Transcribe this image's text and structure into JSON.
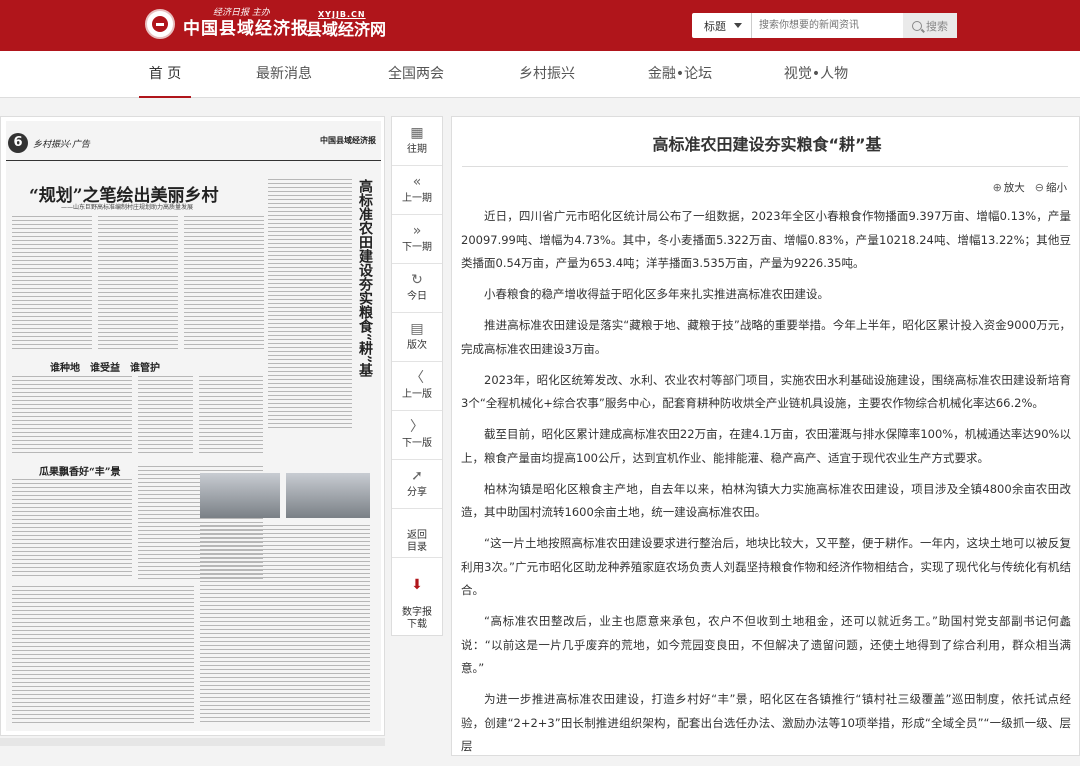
{
  "header": {
    "logo_sub": "经济日报 主办",
    "logo_main": "中国县域经济报",
    "logo2_url": "XYJJB.CN",
    "logo2_main": "县域经济网",
    "search": {
      "select_label": "标题",
      "placeholder": "搜索你想要的新闻资讯",
      "button_label": "搜索"
    }
  },
  "nav": {
    "items": [
      "首 页",
      "最新消息",
      "全国两会",
      "乡村振兴",
      "金融•论坛",
      "视觉•人物"
    ]
  },
  "paper": {
    "page_num": "6",
    "section": "乡村振兴·广告",
    "name": "中国县域经济报",
    "headline": "“规划”之笔绘出美丽乡村",
    "headline_sub": "——山东巨野高标准编制村庄规划助力高质量发展",
    "vertical_headline": "高标准农田建设夯实粮食“耕”基",
    "sub_headline_1": "谁种地　谁受益　谁管护",
    "sub_headline_2": "瓜果飘香好“丰”景"
  },
  "sidebar": {
    "items": [
      {
        "label": "往期",
        "icon": "calendar-icon"
      },
      {
        "label": "上一期",
        "icon": "double-chevron-left-icon"
      },
      {
        "label": "下一期",
        "icon": "double-chevron-right-icon"
      },
      {
        "label": "今日",
        "icon": "refresh-icon"
      },
      {
        "label": "版次",
        "icon": "list-icon"
      },
      {
        "label": "上一版",
        "icon": "circle-chevron-left-icon"
      },
      {
        "label": "下一版",
        "icon": "circle-chevron-right-icon"
      },
      {
        "label": "分享",
        "icon": "share-icon"
      },
      {
        "label": "返回\n目录",
        "icon": ""
      },
      {
        "label": "数字报\n下载",
        "icon": "download-icon"
      }
    ]
  },
  "article": {
    "title": "高标准农田建设夯实粮食“耕”基",
    "zoom_in": "放大",
    "zoom_out": "缩小",
    "paragraphs": [
      "近日，四川省广元市昭化区统计局公布了一组数据，2023年全区小春粮食作物播面9.397万亩、增幅0.13%，产量20097.99吨、增幅为4.73%。其中，冬小麦播面5.322万亩、增幅0.83%，产量10218.24吨、增幅13.22%；其他豆类播面0.54万亩，产量为653.4吨；洋芋播面3.535万亩，产量为9226.35吨。",
      "小春粮食的稳产增收得益于昭化区多年来扎实推进高标准农田建设。",
      "推进高标准农田建设是落实“藏粮于地、藏粮于技”战略的重要举措。今年上半年，昭化区累计投入资金9000万元，完成高标准农田建设3万亩。",
      "2023年，昭化区统筹发改、水利、农业农村等部门项目，实施农田水利基础设施建设，围绕高标准农田建设新培育3个“全程机械化+综合农事”服务中心，配套育耕种防收烘全产业链机具设施，主要农作物综合机械化率达66.2%。",
      "截至目前，昭化区累计建成高标准农田22万亩，在建4.1万亩，农田灌溉与排水保障率100%，机械通达率达90%以上，粮食产量亩均提高100公斤，达到宜机作业、能排能灌、稳产高产、适宜于现代农业生产方式要求。",
      "柏林沟镇是昭化区粮食主产地，自去年以来，柏林沟镇大力实施高标准农田建设，项目涉及全镇4800余亩农田改造，其中助国村流转1600余亩土地，统一建设高标准农田。",
      "“这一片土地按照高标准农田建设要求进行整治后，地块比较大，又平整，便于耕作。一年内，这块土地可以被反复利用3次。”广元市昭化区助龙种养殖家庭农场负责人刘磊坚持粮食作物和经济作物相结合，实现了现代化与传统化有机结合。",
      "“高标准农田整改后，业主也愿意来承包，农户不但收到土地租金，还可以就近务工。”助国村党支部副书记何蠡说：“以前这是一片几乎废弃的荒地，如今荒园变良田，不但解决了遗留问题，还使土地得到了综合利用，群众相当满意。”",
      "为进一步推进高标准农田建设，打造乡村好“丰”景，昭化区在各镇推行“镇村社三级覆盖”巡田制度，依托试点经验，创建“2+2+3”田长制推进组织架构，配套出台选任办法、激励办法等10项举措，形成“全域全员”“一级抓一级、层层"
    ]
  }
}
